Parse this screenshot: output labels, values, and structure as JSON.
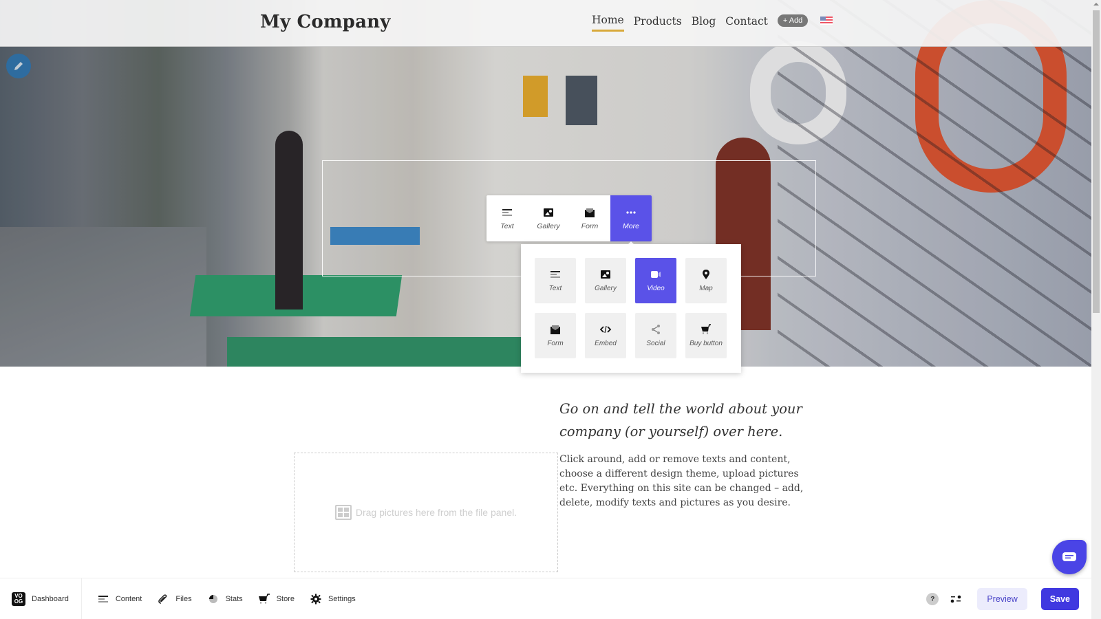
{
  "header": {
    "logo": "My Company",
    "nav": [
      {
        "label": "Home",
        "active": true
      },
      {
        "label": "Products",
        "active": false
      },
      {
        "label": "Blog",
        "active": false
      },
      {
        "label": "Contact",
        "active": false
      }
    ],
    "add_label": "+ Add",
    "language_flag": "us-flag-icon",
    "accent_color": "#d8a93a"
  },
  "quick_toolbar": {
    "items": [
      {
        "label": "Text",
        "icon": "text-icon"
      },
      {
        "label": "Gallery",
        "icon": "gallery-icon"
      },
      {
        "label": "Form",
        "icon": "form-icon"
      },
      {
        "label": "More",
        "icon": "more-dots-icon",
        "active": true
      }
    ]
  },
  "more_panel": {
    "items": [
      {
        "label": "Text",
        "icon": "text-icon"
      },
      {
        "label": "Gallery",
        "icon": "gallery-icon"
      },
      {
        "label": "Video",
        "icon": "video-icon",
        "active": true
      },
      {
        "label": "Map",
        "icon": "map-pin-icon"
      },
      {
        "label": "Form",
        "icon": "form-icon"
      },
      {
        "label": "Embed",
        "icon": "embed-code-icon"
      },
      {
        "label": "Social",
        "icon": "share-icon"
      },
      {
        "label": "Buy button",
        "icon": "cart-icon"
      }
    ],
    "active_color": "#5a52e8"
  },
  "content": {
    "headline": "Go on and tell the world about your company (or yourself) over here.",
    "body": "Click around, add or remove texts and content, choose a different design theme, upload pictures etc. Everything on this site can be changed – add, delete, modify texts and pictures as you desire.",
    "dropzone_text": "Drag pictures here from the file panel."
  },
  "toolbar": {
    "dashboard": "Dashboard",
    "dashboard_logo": "VO OG",
    "items": [
      {
        "label": "Content",
        "icon": "content-lines-icon"
      },
      {
        "label": "Files",
        "icon": "paperclip-icon"
      },
      {
        "label": "Stats",
        "icon": "pie-chart-icon"
      },
      {
        "label": "Store",
        "icon": "cart-icon"
      },
      {
        "label": "Settings",
        "icon": "gear-icon"
      }
    ],
    "help_label": "?",
    "preview_label": "Preview",
    "save_label": "Save",
    "save_color": "#4038e0"
  }
}
